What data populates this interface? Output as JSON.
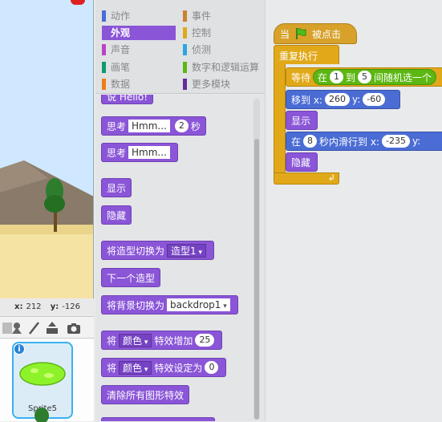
{
  "stage": {
    "mouse_x_label": "x:",
    "mouse_x": "212",
    "mouse_y_label": "y:",
    "mouse_y": "-126"
  },
  "sprite_tools": {
    "icons": [
      "choose-sprite-icon",
      "paint-sprite-icon",
      "upload-sprite-icon",
      "camera-icon"
    ]
  },
  "sprites": {
    "selected_name": "Sprite5",
    "info_glyph": "i"
  },
  "categories": {
    "motion": "动作",
    "events": "事件",
    "looks": "外观",
    "control": "控制",
    "sound": "声音",
    "sensing": "侦测",
    "pen": "画笔",
    "operators": "数字和逻辑运算",
    "data": "数据",
    "more": "更多模块"
  },
  "colors": {
    "motion": "#4a6cd4",
    "events": "#c88330",
    "looks": "#8a55d7",
    "control": "#e1a91a",
    "sound": "#bb42c3",
    "sensing": "#2ca5e2",
    "pen": "#0e9a6c",
    "operators": "#5cb712",
    "data": "#ee7d16",
    "more": "#632d99"
  },
  "palette": {
    "say_partial": "说 Hello!",
    "think_secs": {
      "label": "思考",
      "text": "Hmm...",
      "secs": "2",
      "unit": "秒"
    },
    "think": {
      "label": "思考",
      "text": "Hmm..."
    },
    "show": "显示",
    "hide": "隐藏",
    "switch_costume": {
      "label": "将造型切换为",
      "value": "造型1"
    },
    "next_costume": "下一个造型",
    "switch_backdrop": {
      "label": "将背景切换为",
      "value": "backdrop1"
    },
    "change_effect": {
      "label": "将",
      "effect": "颜色",
      "mid": "特效增加",
      "value": "25"
    },
    "set_effect": {
      "label": "将",
      "effect": "颜色",
      "mid": "特效设定为",
      "value": "0"
    },
    "clear_effects": "清除所有图形特效"
  },
  "script": {
    "hat_when": "当",
    "hat_clicked": "被点击",
    "forever": "重复执行",
    "wait": "等待",
    "random_in": "在",
    "random_from": "1",
    "random_to_word": "到",
    "random_to": "5",
    "random_pick": "间随机选一个",
    "goto_label": "移到 x:",
    "goto_x": "260",
    "goto_y_label": "y:",
    "goto_y": "-60",
    "show": "显示",
    "glide_in": "在",
    "glide_secs": "8",
    "glide_label": "秒内滑行到 x:",
    "glide_x": "-235",
    "glide_y_label": "y:",
    "hide": "隐藏"
  }
}
